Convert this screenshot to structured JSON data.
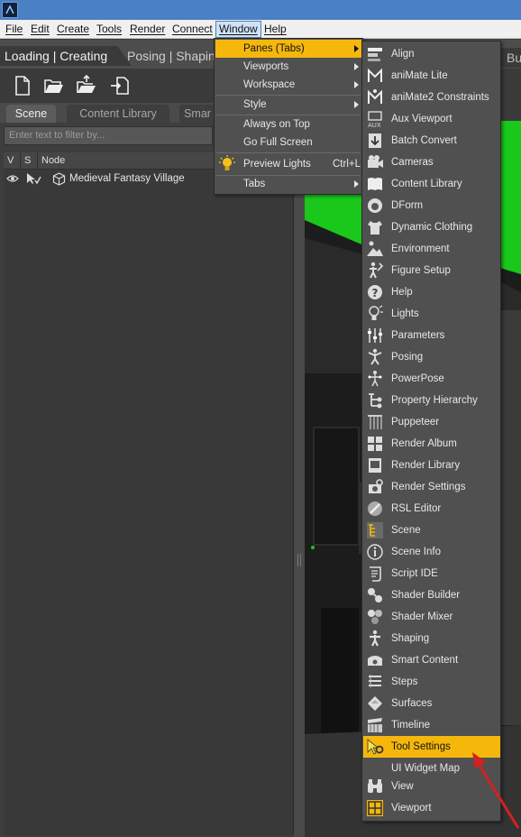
{
  "menubar": {
    "items": [
      {
        "label": "File"
      },
      {
        "label": "Edit"
      },
      {
        "label": "Create"
      },
      {
        "label": "Tools"
      },
      {
        "label": "Render"
      },
      {
        "label": "Connect"
      },
      {
        "label": "Window"
      },
      {
        "label": "Help"
      }
    ]
  },
  "perspective_tabs": {
    "active": "Loading | Creating",
    "second": "Posing | Shaping",
    "right_partial": "Bu"
  },
  "pane_tabs": {
    "scene": "Scene",
    "content_library": "Content Library",
    "smart": "Smar"
  },
  "scene_pane": {
    "filter_placeholder": "Enter text to filter by...",
    "columns": {
      "v": "V",
      "s": "S",
      "node": "Node"
    },
    "nodes": [
      {
        "label": "Medieval Fantasy Village"
      }
    ]
  },
  "window_menu": {
    "items": [
      {
        "label": "Panes (Tabs)"
      },
      {
        "label": "Viewports"
      },
      {
        "label": "Workspace"
      },
      {
        "label": "Style"
      },
      {
        "label": "Always on Top"
      },
      {
        "label": "Go Full Screen"
      },
      {
        "label": "Preview Lights",
        "shortcut": "Ctrl+L"
      },
      {
        "label": "Tabs"
      }
    ]
  },
  "panes_menu": {
    "items": [
      {
        "label": "Align",
        "icon": "align-icon"
      },
      {
        "label": "aniMate Lite",
        "icon": "animate-lite-icon"
      },
      {
        "label": "aniMate2 Constraints",
        "icon": "animate2-constraints-icon"
      },
      {
        "label": "Aux Viewport",
        "icon": "aux-viewport-icon"
      },
      {
        "label": "Batch Convert",
        "icon": "batch-convert-icon"
      },
      {
        "label": "Cameras",
        "icon": "camera-icon"
      },
      {
        "label": "Content Library",
        "icon": "book-icon"
      },
      {
        "label": "DForm",
        "icon": "dform-icon"
      },
      {
        "label": "Dynamic Clothing",
        "icon": "dynamic-clothing-icon"
      },
      {
        "label": "Environment",
        "icon": "environment-icon"
      },
      {
        "label": "Figure Setup",
        "icon": "figure-setup-icon"
      },
      {
        "label": "Help",
        "icon": "help-icon"
      },
      {
        "label": "Lights",
        "icon": "light-bulb-icon"
      },
      {
        "label": "Parameters",
        "icon": "parameters-icon"
      },
      {
        "label": "Posing",
        "icon": "posing-icon"
      },
      {
        "label": "PowerPose",
        "icon": "powerpose-icon"
      },
      {
        "label": "Property Hierarchy",
        "icon": "property-hierarchy-icon"
      },
      {
        "label": "Puppeteer",
        "icon": "puppeteer-icon"
      },
      {
        "label": "Render Album",
        "icon": "render-album-icon"
      },
      {
        "label": "Render Library",
        "icon": "render-library-icon"
      },
      {
        "label": "Render Settings",
        "icon": "render-settings-icon"
      },
      {
        "label": "RSL Editor",
        "icon": "rsl-editor-icon"
      },
      {
        "label": "Scene",
        "icon": "scene-icon"
      },
      {
        "label": "Scene Info",
        "icon": "scene-info-icon"
      },
      {
        "label": "Script IDE",
        "icon": "script-ide-icon"
      },
      {
        "label": "Shader Builder",
        "icon": "shader-builder-icon"
      },
      {
        "label": "Shader Mixer",
        "icon": "shader-mixer-icon"
      },
      {
        "label": "Shaping",
        "icon": "shaping-icon"
      },
      {
        "label": "Smart Content",
        "icon": "smart-content-icon"
      },
      {
        "label": "Steps",
        "icon": "steps-icon"
      },
      {
        "label": "Surfaces",
        "icon": "surfaces-icon"
      },
      {
        "label": "Timeline",
        "icon": "timeline-icon"
      },
      {
        "label": "Tool Settings",
        "icon": "tool-settings-icon"
      },
      {
        "label": "UI Widget Map",
        "icon": ""
      },
      {
        "label": "View",
        "icon": "binoculars-icon"
      },
      {
        "label": "Viewport",
        "icon": "viewport-icon"
      }
    ]
  },
  "colors": {
    "highlight": "#f5b70c",
    "menu_bg": "#505050",
    "viewport_green": "#19c81a",
    "annotation_arrow": "#d42020"
  }
}
